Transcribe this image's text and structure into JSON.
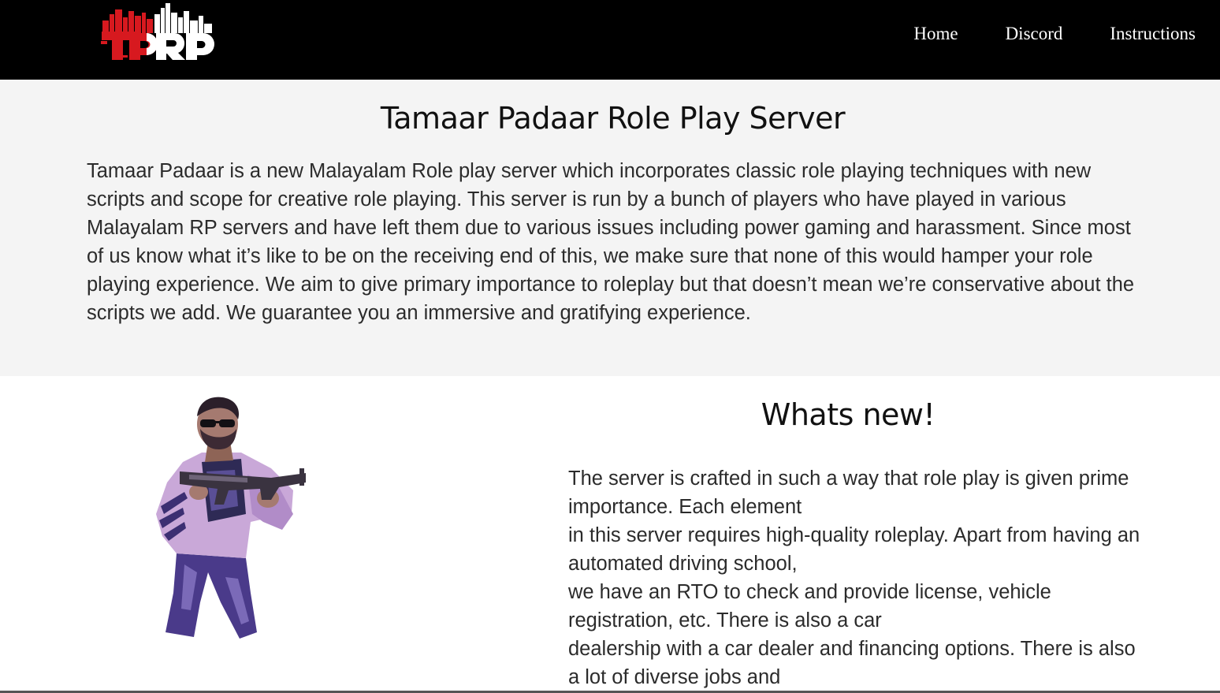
{
  "brand": {
    "logo_text": "TPRP",
    "colors": {
      "red": "#d7191f",
      "white": "#ffffff",
      "black": "#000000"
    }
  },
  "nav": {
    "items": [
      {
        "label": "Home"
      },
      {
        "label": "Discord"
      },
      {
        "label": "Instructions"
      }
    ]
  },
  "intro": {
    "title": "Tamaar Padaar Role Play Server",
    "body": "Tamaar Padaar is a new Malayalam Role play server which incorporates classic role playing techniques with new scripts and scope for creative role playing. This server is run by a bunch of players who have played in various Malayalam RP servers and have left them due to various issues including power gaming and harassment. Since most of us know what it’s like to be on the receiving end of this, we make sure that none of this would hamper your role playing experience. We aim to give primary importance to roleplay but that doesn’t mean we’re conservative about the scripts we add. We guarantee you an immersive and gratifying experience."
  },
  "whats_new": {
    "title": "Whats new!",
    "lines": [
      "The server is crafted in such a way that role play is given prime importance. Each element",
      "in this server requires high-quality roleplay. Apart from having an automated driving school,",
      "we have an RTO to check and provide license, vehicle registration, etc. There is also a car",
      "dealership with a car dealer and financing options. There is also a lot of diverse jobs and"
    ]
  }
}
